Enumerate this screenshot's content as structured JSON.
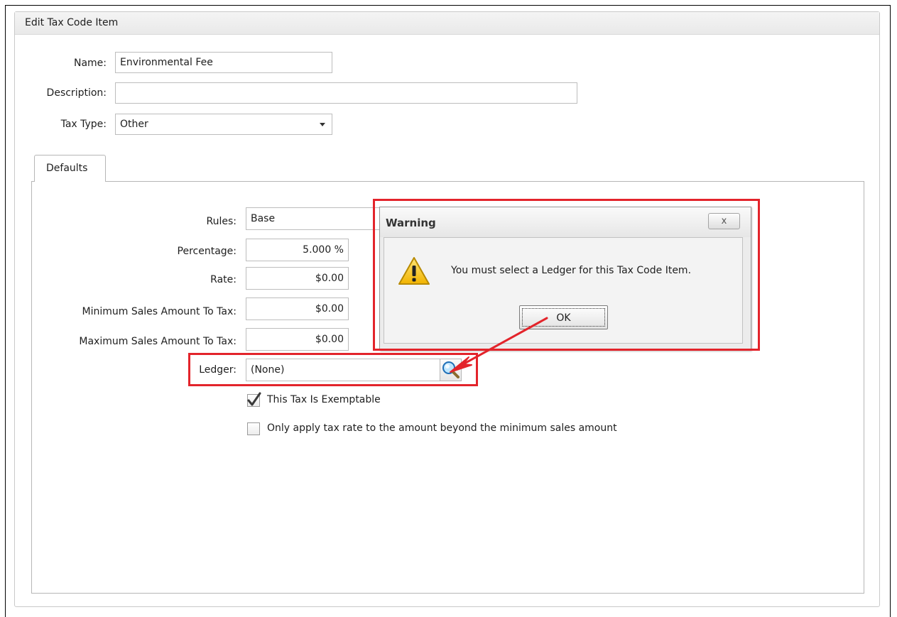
{
  "form": {
    "group_title": "Edit Tax Code Item",
    "name_label": "Name:",
    "name_value": "Environmental Fee",
    "description_label": "Description:",
    "description_value": "",
    "tax_type_label": "Tax Type:",
    "tax_type_value": "Other"
  },
  "tabs": [
    {
      "label": "Defaults",
      "active": true
    }
  ],
  "defaults": {
    "rules_label": "Rules:",
    "rules_value": "Base",
    "percentage_label": "Percentage:",
    "percentage_value": "5.000 %",
    "rate_label": "Rate:",
    "rate_value": "$0.00",
    "min_sales_label": "Minimum Sales Amount To Tax:",
    "min_sales_value": "$0.00",
    "max_sales_label": "Maximum Sales Amount To Tax:",
    "max_sales_value": "$0.00",
    "ledger_label": "Ledger:",
    "ledger_value": "(None)",
    "exemptable_label": "This Tax Is Exemptable",
    "exemptable_checked": true,
    "beyond_min_label": "Only apply tax rate to the amount beyond the minimum sales amount",
    "beyond_min_checked": false
  },
  "dialog": {
    "title": "Warning",
    "close_label": "x",
    "message": "You must select a Ledger for this Tax Code Item.",
    "ok_label": "OK"
  },
  "icons": {
    "warning": "warning-icon",
    "lookup": "magnifier-icon",
    "dropdown": "chevron-down-icon",
    "check": "check-icon"
  },
  "colors": {
    "annotation_red": "#e3242b",
    "warning_yellow": "#f2c21b"
  }
}
